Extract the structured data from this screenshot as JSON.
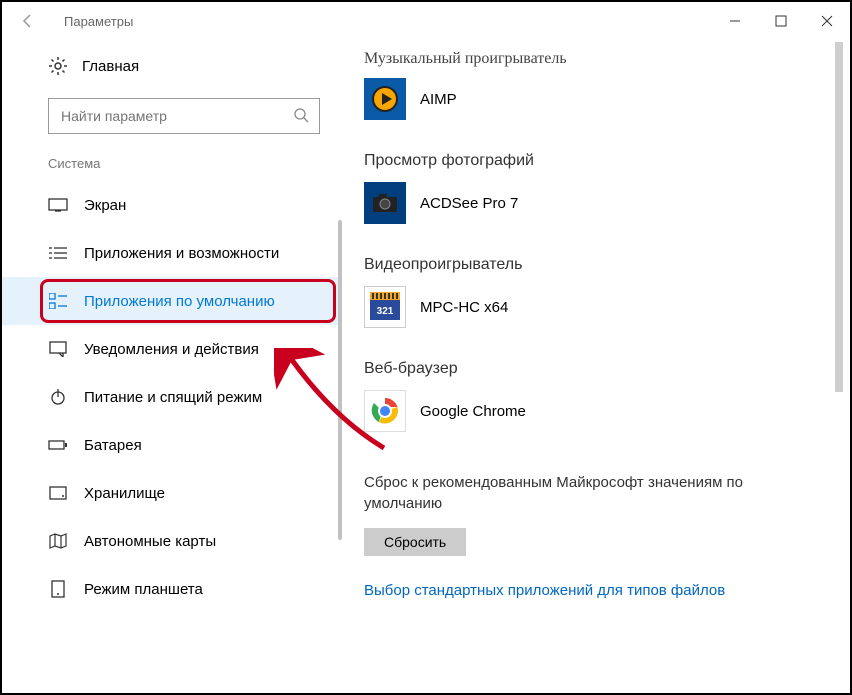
{
  "window": {
    "title": "Параметры"
  },
  "sidebar": {
    "home": "Главная",
    "search_placeholder": "Найти параметр",
    "category": "Система",
    "items": [
      {
        "label": "Экран"
      },
      {
        "label": "Приложения и возможности"
      },
      {
        "label": "Приложения по умолчанию"
      },
      {
        "label": "Уведомления и действия"
      },
      {
        "label": "Питание и спящий режим"
      },
      {
        "label": "Батарея"
      },
      {
        "label": "Хранилище"
      },
      {
        "label": "Автономные карты"
      },
      {
        "label": "Режим планшета"
      }
    ]
  },
  "content": {
    "truncated_header": "Музыкальный проигрыватель",
    "sections": [
      {
        "title": "",
        "app": "AIMP"
      },
      {
        "title": "Просмотр фотографий",
        "app": "ACDSee Pro 7"
      },
      {
        "title": "Видеопроигрыватель",
        "app": "MPC-HC x64"
      },
      {
        "title": "Веб-браузер",
        "app": "Google Chrome"
      }
    ],
    "reset_text": "Сброс к рекомендованным Майкрософт значениям по умолчанию",
    "reset_button": "Сбросить",
    "link1": "Выбор стандартных приложений для типов файлов"
  }
}
